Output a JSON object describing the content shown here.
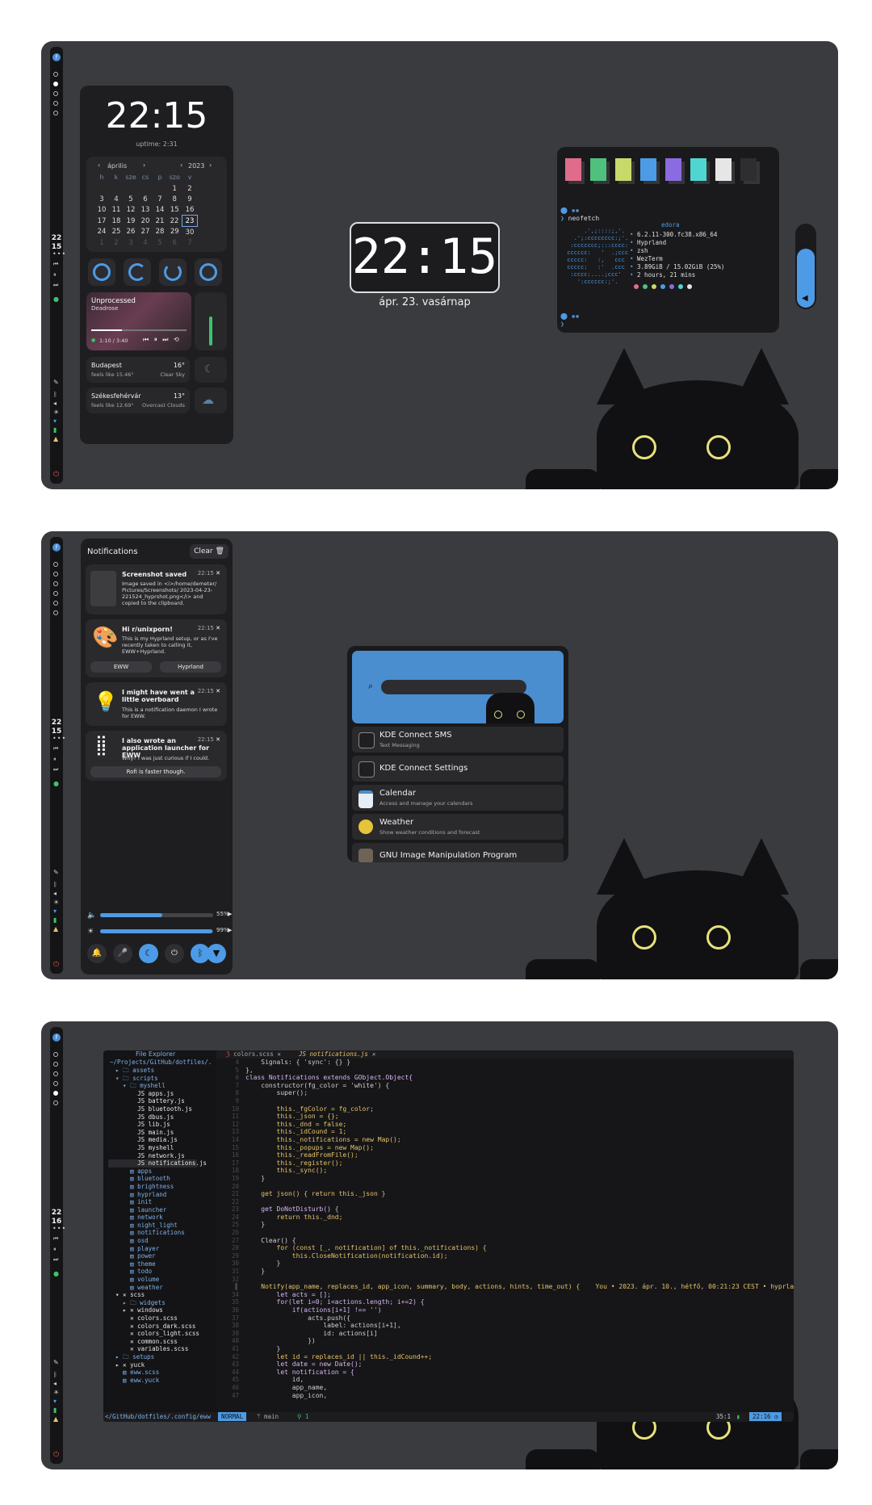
{
  "bar": {
    "clock_1": {
      "hour": "22",
      "minute": "15"
    },
    "clock_2": {
      "hour": "22",
      "minute": "15"
    },
    "clock_3": {
      "hour": "22",
      "minute": "16"
    }
  },
  "dashboard": {
    "clock": "22:15",
    "uptime": "uptime: 2:31",
    "calendar": {
      "month": "április",
      "year": "2023",
      "weekdays": [
        "h",
        "k",
        "sze",
        "cs",
        "p",
        "szo",
        "v"
      ],
      "weeks": [
        [
          "",
          "",
          "",
          "",
          "",
          "1",
          "2"
        ],
        [
          "3",
          "4",
          "5",
          "6",
          "7",
          "8",
          "9"
        ],
        [
          "10",
          "11",
          "12",
          "13",
          "14",
          "15",
          "16"
        ],
        [
          "17",
          "18",
          "19",
          "20",
          "21",
          "22",
          "23"
        ],
        [
          "24",
          "25",
          "26",
          "27",
          "28",
          "29",
          "30"
        ],
        [
          "1",
          "2",
          "3",
          "4",
          "5",
          "6",
          "7"
        ]
      ],
      "today": "23"
    },
    "media": {
      "title": "Unprocessed",
      "artist": "Deadrose",
      "time": "1:10 / 3:40",
      "progress": 0.32
    },
    "weather": [
      {
        "city": "Budapest",
        "feels": "feels like 15.46°",
        "temp": "16°",
        "cond": "Clear Sky"
      },
      {
        "city": "Székesfehérvár",
        "feels": "feels like 12.69°",
        "temp": "13°",
        "cond": "Overcast Clouds"
      }
    ]
  },
  "desktop": {
    "clock": "22:15",
    "date": "ápr. 23. vasárnap"
  },
  "terminal": {
    "command": "neofetch",
    "logo_label": "edora",
    "info": [
      "6.2.11-300.fc38.x86_64",
      "Hyprland",
      "zsh",
      "WezTerm",
      "3.89GiB / 15.02GiB (25%)",
      "2 hours, 21 mins"
    ],
    "palette": [
      "#e06c8c",
      "#4fc07e",
      "#c7d96a",
      "#4d9be6",
      "#8a6be0",
      "#4fd6d0",
      "#e6e6e6",
      "#2e2e30"
    ]
  },
  "volume": {
    "level": 0.72
  },
  "notifications": {
    "header": "Notifications",
    "clear_label": "Clear",
    "items": [
      {
        "title": "Screenshot saved",
        "time": "22:15",
        "body": "Image saved in <i>/home/demeter/ Pictures/Screenshots/ 2023-04-23-221524_hyprshot.png</i> and copied to the clipboard."
      },
      {
        "title": "Hi r/unixporn!",
        "time": "22:15",
        "body": "This is my Hyprland setup, or as I've recently taken to calling it, EWW+Hyprland.",
        "actions": [
          "EWW",
          "Hyprland"
        ]
      },
      {
        "title": "I might have went a little overboard",
        "time": "22:15",
        "body": "This is a notification daemon I wrote for EWW."
      },
      {
        "title": "I also wrote an application launcher for EWW",
        "time": "22:15",
        "body": "Why? I was just curious if I could.",
        "actions": [
          "Rofi is faster though."
        ]
      }
    ],
    "sliders": [
      {
        "icon": "speaker-icon",
        "percent": "55%",
        "level": 0.55
      },
      {
        "icon": "brightness-icon",
        "percent": "99%",
        "level": 0.99
      }
    ]
  },
  "launcher": {
    "items": [
      {
        "name": "KDE Connect SMS",
        "desc": "Text Messaging"
      },
      {
        "name": "KDE Connect Settings",
        "desc": ""
      },
      {
        "name": "Calendar",
        "desc": "Access and manage your calendars"
      },
      {
        "name": "Weather",
        "desc": "Show weather conditions and forecast"
      },
      {
        "name": "GNU Image Manipulation Program",
        "desc": ""
      }
    ]
  },
  "editor": {
    "explorer_title": "File Explorer",
    "explorer_path": "~/Projects/GitHub/dotfiles/.",
    "tabs": [
      "colors.scss",
      "notifications.js"
    ],
    "tree": [
      "  ▸ 🗀 assets",
      "  ▾ 🗀 scripts",
      "    ▾ 🗀 myshell",
      "        JS apps.js",
      "        JS battery.js",
      "        JS bluetooth.js",
      "        JS dbus.js",
      "        JS lib.js",
      "        JS main.js",
      "        JS media.js",
      "        JS myshell",
      "        JS network.js",
      "        JS notifications.js",
      "      ▤ apps",
      "      ▤ bluetooth",
      "      ▤ brightness",
      "      ▤ hyprland",
      "      ▤ init",
      "      ▤ launcher",
      "      ▤ network",
      "      ▤ night_light",
      "      ▤ notifications",
      "      ▤ osd",
      "      ▤ player",
      "      ▤ power",
      "      ▤ theme",
      "      ▤ todo",
      "      ▤ volume",
      "      ▤ weather",
      "  ▾ ✕ scss",
      "    ▸ 🗀 widgets",
      "    ▸ ✕ windows",
      "      ✕ colors.scss",
      "      ✕ colors_dark.scss",
      "      ✕ colors_light.scss",
      "      ✕ common.scss",
      "      ✕ variables.scss",
      "  ▸ 🗀 setups",
      "  ▸ ✕ yuck",
      "    ▤ eww.scss",
      "    ▤ eww.yuck"
    ],
    "code": [
      "    Signals: { 'sync': {} }",
      "},",
      "class Notifications extends GObject.Object{",
      "    constructor(fg_color = 'white') {",
      "        super();",
      "",
      "        this._fgColor = fg_color;",
      "        this._json = {};",
      "        this._dnd = false;",
      "        this._idCound = 1;",
      "        this._notifications = new Map();",
      "        this._popups = new Map();",
      "        this._readFromFile();",
      "        this._register();",
      "        this._sync();",
      "    }",
      "",
      "    get json() { return this._json }",
      "",
      "    get DoNotDisturb() {",
      "        return this._dnd;",
      "    }",
      "",
      "    Clear() {",
      "        for (const [_, notification] of this._notifications) {",
      "            this.CloseNotification(notification.id);",
      "        }",
      "    }",
      "",
      "    Notify(app_name, replaces_id, app_icon, summary, body, actions, hints, time_out) {    You • 2023. ápr. 10., hétfő, 00:21:23 CEST • hyprland",
      "        let acts = [];",
      "        for(let i=0; i<actions.length; i+=2) {",
      "            if(actions[i+1] !== '')",
      "                acts.push({",
      "                    label: actions[i+1],",
      "                    id: actions[i]",
      "                })",
      "        }",
      "        let id = replaces_id || this._idCound++;",
      "        let date = new Date();",
      "        let notification = {",
      "            id,",
      "            app_name,",
      "            app_icon,"
    ],
    "status": {
      "path": "</GitHub/dotfiles/.config/eww",
      "mode": "NORMAL",
      "branch": "main",
      "diag": "1",
      "pos": "35:1",
      "time": "22:16"
    }
  }
}
